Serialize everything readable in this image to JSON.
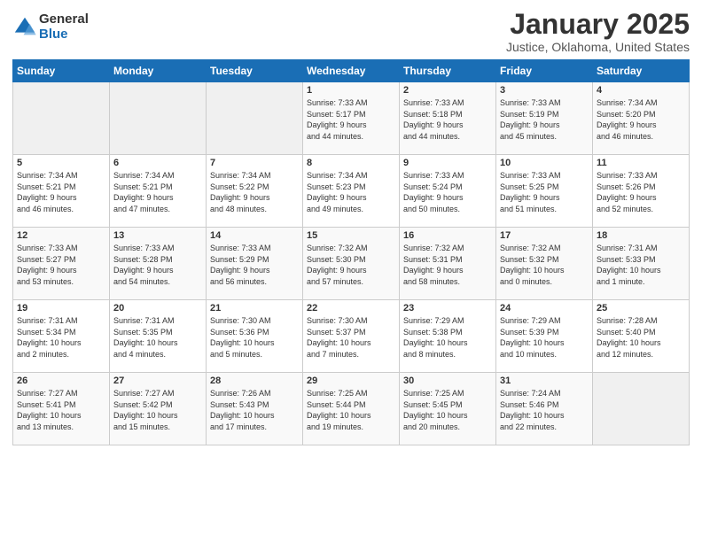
{
  "logo": {
    "general": "General",
    "blue": "Blue"
  },
  "title": "January 2025",
  "subtitle": "Justice, Oklahoma, United States",
  "headers": [
    "Sunday",
    "Monday",
    "Tuesday",
    "Wednesday",
    "Thursday",
    "Friday",
    "Saturday"
  ],
  "weeks": [
    [
      {
        "day": "",
        "info": ""
      },
      {
        "day": "",
        "info": ""
      },
      {
        "day": "",
        "info": ""
      },
      {
        "day": "1",
        "info": "Sunrise: 7:33 AM\nSunset: 5:17 PM\nDaylight: 9 hours\nand 44 minutes."
      },
      {
        "day": "2",
        "info": "Sunrise: 7:33 AM\nSunset: 5:18 PM\nDaylight: 9 hours\nand 44 minutes."
      },
      {
        "day": "3",
        "info": "Sunrise: 7:33 AM\nSunset: 5:19 PM\nDaylight: 9 hours\nand 45 minutes."
      },
      {
        "day": "4",
        "info": "Sunrise: 7:34 AM\nSunset: 5:20 PM\nDaylight: 9 hours\nand 46 minutes."
      }
    ],
    [
      {
        "day": "5",
        "info": "Sunrise: 7:34 AM\nSunset: 5:21 PM\nDaylight: 9 hours\nand 46 minutes."
      },
      {
        "day": "6",
        "info": "Sunrise: 7:34 AM\nSunset: 5:21 PM\nDaylight: 9 hours\nand 47 minutes."
      },
      {
        "day": "7",
        "info": "Sunrise: 7:34 AM\nSunset: 5:22 PM\nDaylight: 9 hours\nand 48 minutes."
      },
      {
        "day": "8",
        "info": "Sunrise: 7:34 AM\nSunset: 5:23 PM\nDaylight: 9 hours\nand 49 minutes."
      },
      {
        "day": "9",
        "info": "Sunrise: 7:33 AM\nSunset: 5:24 PM\nDaylight: 9 hours\nand 50 minutes."
      },
      {
        "day": "10",
        "info": "Sunrise: 7:33 AM\nSunset: 5:25 PM\nDaylight: 9 hours\nand 51 minutes."
      },
      {
        "day": "11",
        "info": "Sunrise: 7:33 AM\nSunset: 5:26 PM\nDaylight: 9 hours\nand 52 minutes."
      }
    ],
    [
      {
        "day": "12",
        "info": "Sunrise: 7:33 AM\nSunset: 5:27 PM\nDaylight: 9 hours\nand 53 minutes."
      },
      {
        "day": "13",
        "info": "Sunrise: 7:33 AM\nSunset: 5:28 PM\nDaylight: 9 hours\nand 54 minutes."
      },
      {
        "day": "14",
        "info": "Sunrise: 7:33 AM\nSunset: 5:29 PM\nDaylight: 9 hours\nand 56 minutes."
      },
      {
        "day": "15",
        "info": "Sunrise: 7:32 AM\nSunset: 5:30 PM\nDaylight: 9 hours\nand 57 minutes."
      },
      {
        "day": "16",
        "info": "Sunrise: 7:32 AM\nSunset: 5:31 PM\nDaylight: 9 hours\nand 58 minutes."
      },
      {
        "day": "17",
        "info": "Sunrise: 7:32 AM\nSunset: 5:32 PM\nDaylight: 10 hours\nand 0 minutes."
      },
      {
        "day": "18",
        "info": "Sunrise: 7:31 AM\nSunset: 5:33 PM\nDaylight: 10 hours\nand 1 minute."
      }
    ],
    [
      {
        "day": "19",
        "info": "Sunrise: 7:31 AM\nSunset: 5:34 PM\nDaylight: 10 hours\nand 2 minutes."
      },
      {
        "day": "20",
        "info": "Sunrise: 7:31 AM\nSunset: 5:35 PM\nDaylight: 10 hours\nand 4 minutes."
      },
      {
        "day": "21",
        "info": "Sunrise: 7:30 AM\nSunset: 5:36 PM\nDaylight: 10 hours\nand 5 minutes."
      },
      {
        "day": "22",
        "info": "Sunrise: 7:30 AM\nSunset: 5:37 PM\nDaylight: 10 hours\nand 7 minutes."
      },
      {
        "day": "23",
        "info": "Sunrise: 7:29 AM\nSunset: 5:38 PM\nDaylight: 10 hours\nand 8 minutes."
      },
      {
        "day": "24",
        "info": "Sunrise: 7:29 AM\nSunset: 5:39 PM\nDaylight: 10 hours\nand 10 minutes."
      },
      {
        "day": "25",
        "info": "Sunrise: 7:28 AM\nSunset: 5:40 PM\nDaylight: 10 hours\nand 12 minutes."
      }
    ],
    [
      {
        "day": "26",
        "info": "Sunrise: 7:27 AM\nSunset: 5:41 PM\nDaylight: 10 hours\nand 13 minutes."
      },
      {
        "day": "27",
        "info": "Sunrise: 7:27 AM\nSunset: 5:42 PM\nDaylight: 10 hours\nand 15 minutes."
      },
      {
        "day": "28",
        "info": "Sunrise: 7:26 AM\nSunset: 5:43 PM\nDaylight: 10 hours\nand 17 minutes."
      },
      {
        "day": "29",
        "info": "Sunrise: 7:25 AM\nSunset: 5:44 PM\nDaylight: 10 hours\nand 19 minutes."
      },
      {
        "day": "30",
        "info": "Sunrise: 7:25 AM\nSunset: 5:45 PM\nDaylight: 10 hours\nand 20 minutes."
      },
      {
        "day": "31",
        "info": "Sunrise: 7:24 AM\nSunset: 5:46 PM\nDaylight: 10 hours\nand 22 minutes."
      },
      {
        "day": "",
        "info": ""
      }
    ]
  ]
}
